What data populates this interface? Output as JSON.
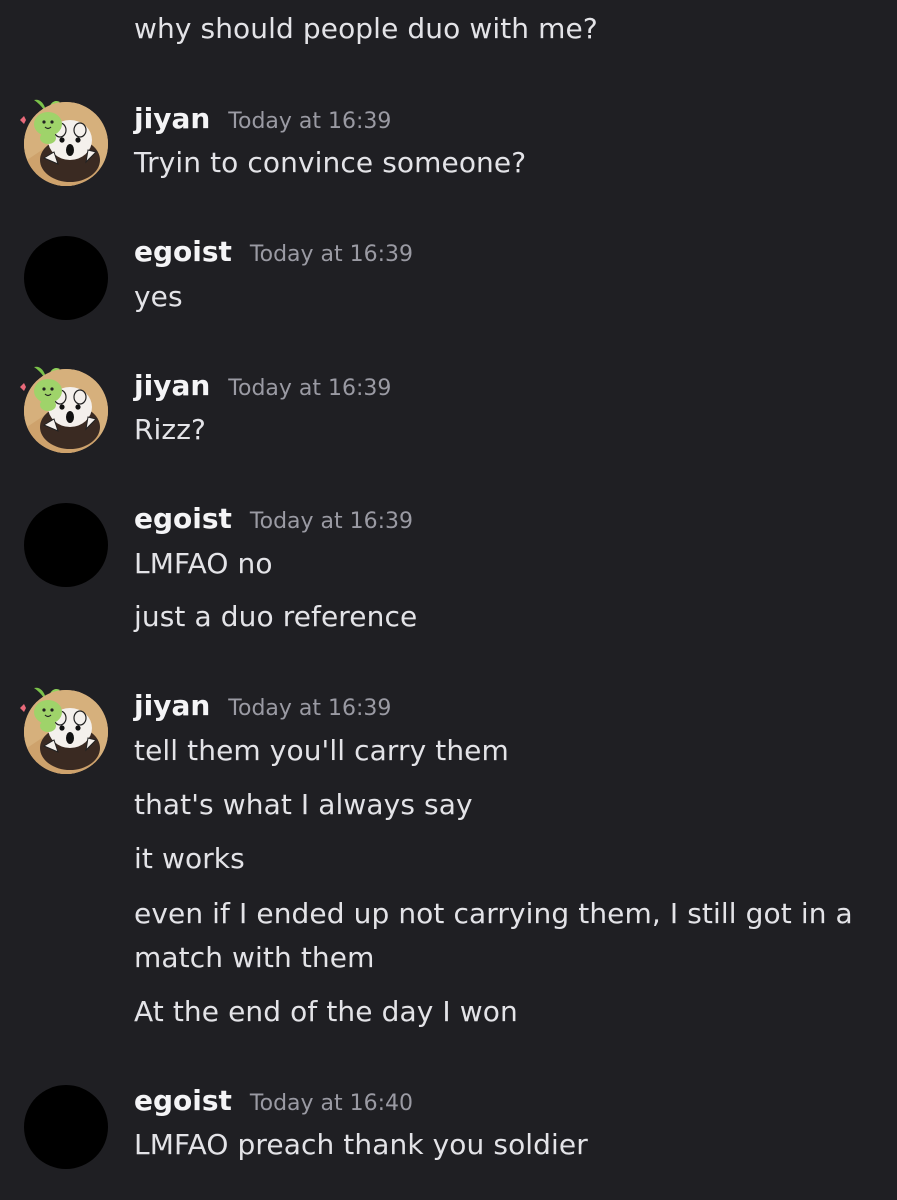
{
  "colors": {
    "background": "#1f1f23",
    "message_text": "#e3e3e7",
    "username": "#f4f4f6",
    "timestamp": "#9a9aa3",
    "avatar_placeholder": "#000000",
    "avatar_jiyan_bg": "#d9b483"
  },
  "messages": [
    {
      "lines": [
        "why should people duo with me?"
      ]
    },
    {
      "author": "jiyan",
      "timestamp": "Today at 16:39",
      "avatar": "cat-with-green-plant-avatar",
      "lines": [
        "Tryin to convince someone?"
      ]
    },
    {
      "author": "egoist",
      "timestamp": "Today at 16:39",
      "avatar": "black-circle-avatar",
      "lines": [
        "yes"
      ]
    },
    {
      "author": "jiyan",
      "timestamp": "Today at 16:39",
      "avatar": "cat-with-green-plant-avatar",
      "lines": [
        "Rizz?"
      ]
    },
    {
      "author": "egoist",
      "timestamp": "Today at 16:39",
      "avatar": "black-circle-avatar",
      "lines": [
        "LMFAO no",
        "just a duo reference"
      ]
    },
    {
      "author": "jiyan",
      "timestamp": "Today at 16:39",
      "avatar": "cat-with-green-plant-avatar",
      "lines": [
        "tell them you'll carry them",
        "that's what I always say",
        "it works",
        "even if I ended up not carrying them, I still got in a match with them",
        "At the end of the day I won"
      ]
    },
    {
      "author": "egoist",
      "timestamp": "Today at 16:40",
      "avatar": "black-circle-avatar",
      "lines": [
        "LMFAO preach thank you soldier"
      ]
    }
  ]
}
